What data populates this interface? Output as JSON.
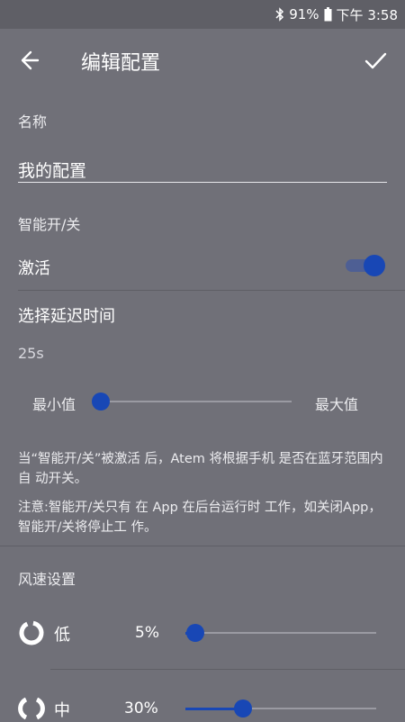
{
  "status_bar": {
    "battery": "91%",
    "time": "下午 3:58"
  },
  "header": {
    "title": "编辑配置"
  },
  "name_section": {
    "label": "名称",
    "value": "我的配置"
  },
  "smart_section": {
    "label": "智能开/关",
    "activate_label": "激活",
    "activate_on": true,
    "delay_label": "选择延迟时间",
    "delay_value": "25s",
    "min_label": "最小值",
    "max_label": "最大值",
    "delay_slider_fraction": 0.0,
    "note1": "当“智能开/关”被激活 后，Atem 将根据手机 是否在蓝牙范围内自 动开关。",
    "note2": "注意:智能开/关只有 在 App 在后台运行时 工作，如关闭App，智能开/关将停止工 作。"
  },
  "fan_section": {
    "label": "风速设置",
    "rows": [
      {
        "label": "低",
        "percent": "5%",
        "level": 0.05
      },
      {
        "label": "中",
        "percent": "30%",
        "level": 0.3
      }
    ]
  },
  "colors": {
    "background": "#707078",
    "accent": "#1847b5",
    "status_bar": "#5f5f66"
  },
  "icons": {
    "back": "arrow-left-icon",
    "confirm": "check-icon",
    "bluetooth": "bluetooth-icon",
    "battery": "battery-icon",
    "fan": "fan-ring-icon"
  }
}
